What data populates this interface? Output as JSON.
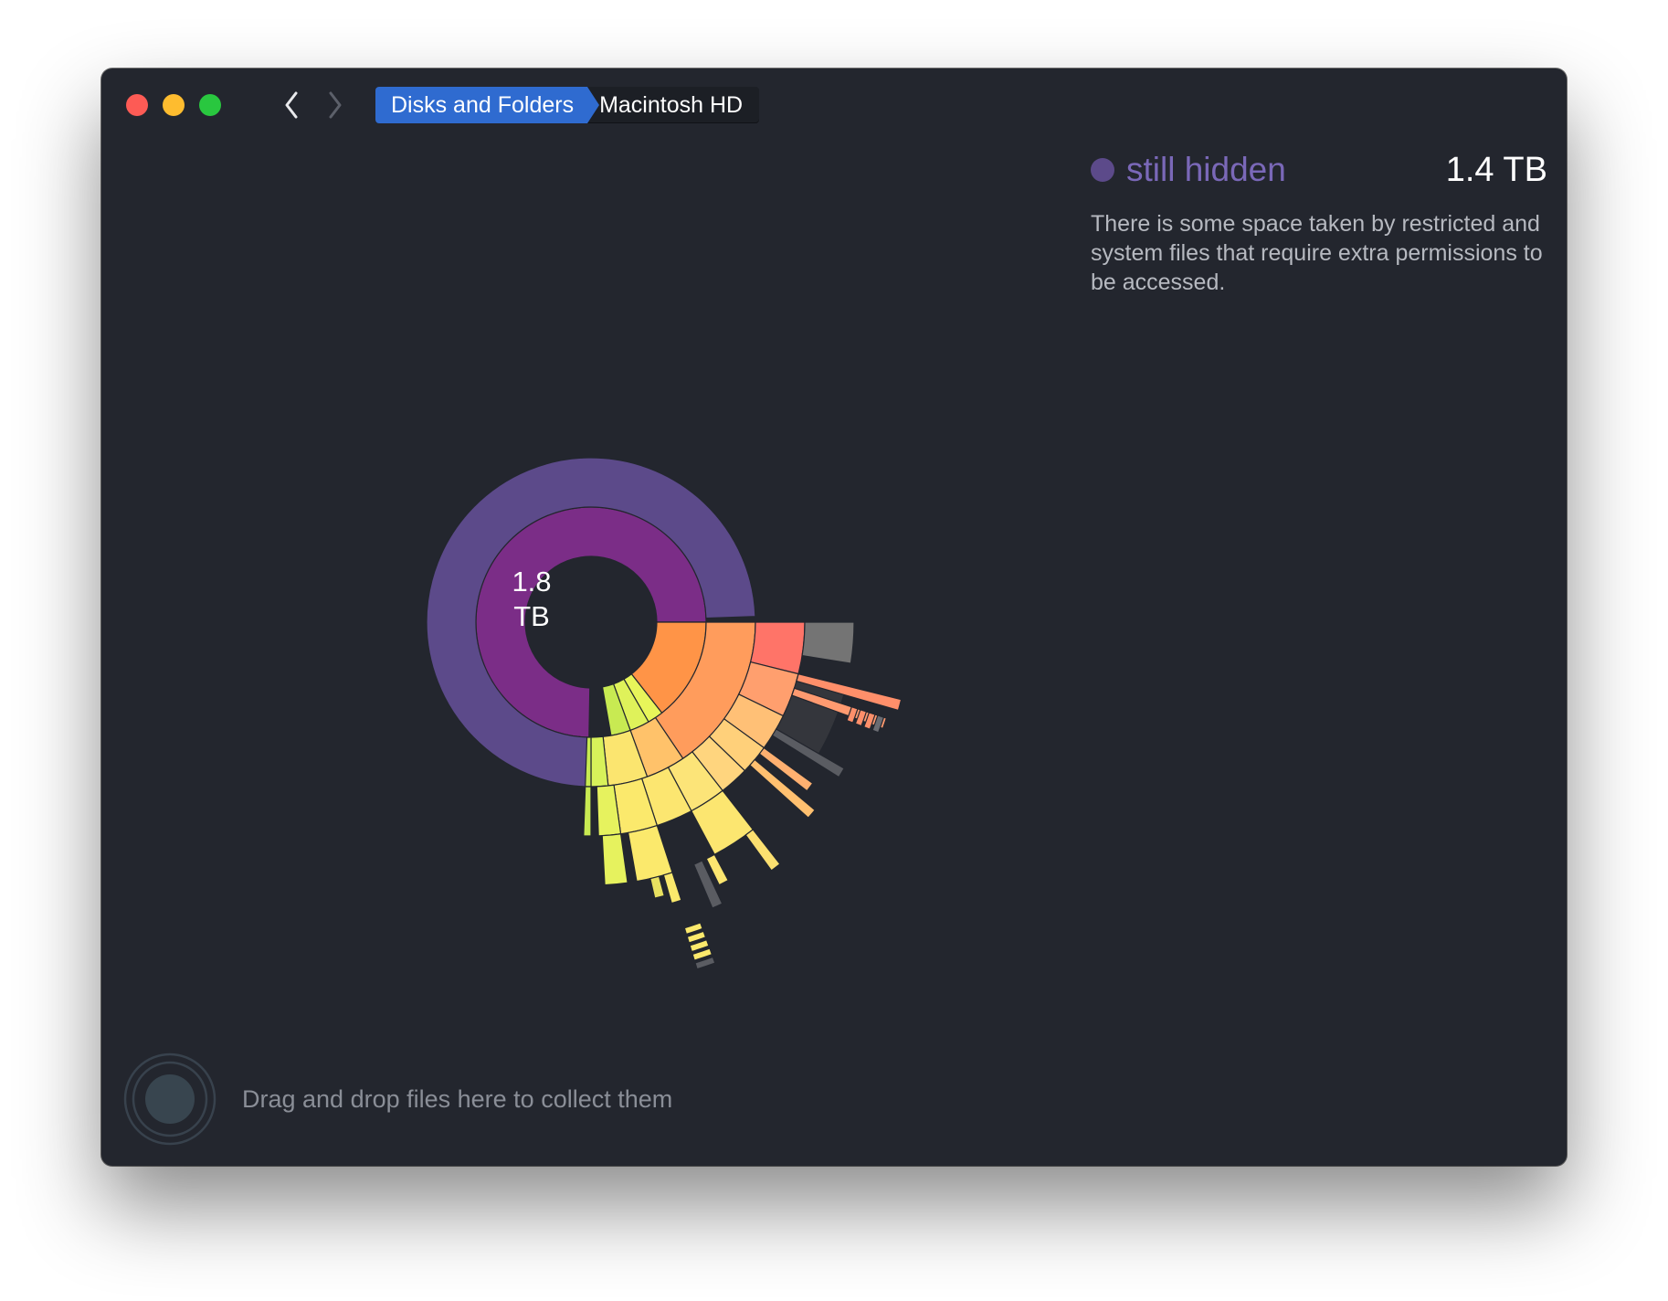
{
  "toolbar": {
    "back_icon": "chevron-left-icon",
    "forward_icon": "chevron-right-icon"
  },
  "breadcrumb": {
    "root": "Disks and Folders",
    "current": "Macintosh HD"
  },
  "info": {
    "title": "still hidden",
    "size": "1.4 TB",
    "description": "There is some space taken by restricted and system files that require extra permissions to be accessed.",
    "color": "#5c4a8a"
  },
  "chart": {
    "center_value": "1.8",
    "center_unit": "TB"
  },
  "drop_zone": {
    "text": "Drag and drop files here to collect them",
    "icon": "drop-target-icon"
  },
  "colors": {
    "window_bg": "#23262e",
    "accent": "#2f6bd0",
    "hidden": "#5c4a8a",
    "disk": "#7b2d87"
  }
}
